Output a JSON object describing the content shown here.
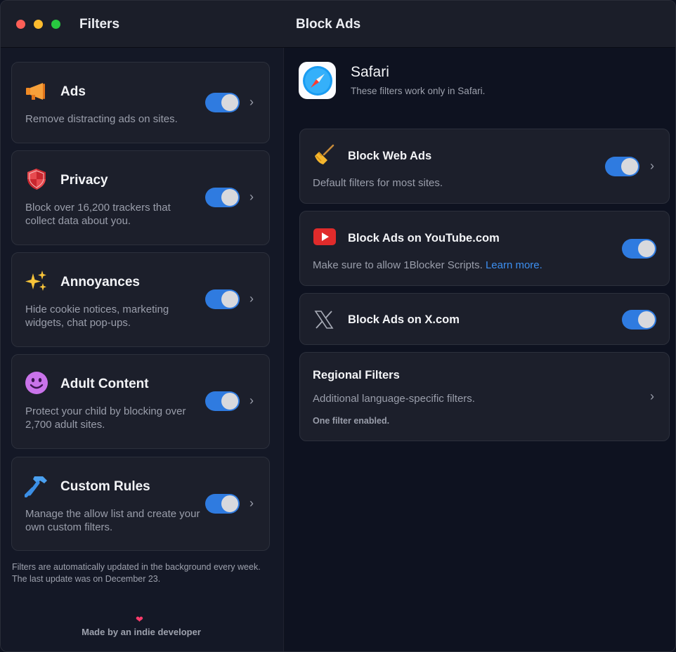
{
  "titlebar": {
    "sidebar_title": "Filters",
    "main_title": "Block Ads"
  },
  "sidebar": {
    "items": [
      {
        "title": "Ads",
        "desc": "Remove distracting ads on sites.",
        "icon": "megaphone-icon",
        "enabled": true
      },
      {
        "title": "Privacy",
        "desc": "Block over 16,200 trackers that collect data about you.",
        "icon": "shield-icon",
        "enabled": true
      },
      {
        "title": "Annoyances",
        "desc": "Hide cookie notices, marketing widgets, chat pop-ups.",
        "icon": "sparkles-icon",
        "enabled": true
      },
      {
        "title": "Adult Content",
        "desc": "Protect your child by blocking over 2,700 adult sites.",
        "icon": "smiley-icon",
        "enabled": true
      },
      {
        "title": "Custom Rules",
        "desc": "Manage the allow list and create your own custom filters.",
        "icon": "hammer-icon",
        "enabled": true
      }
    ],
    "footer_note": "Filters are automatically updated in the background every week. The last update was on December 23.",
    "made_by": "Made by an indie developer"
  },
  "main": {
    "browser": {
      "name": "Safari",
      "desc": "These filters work only in Safari.",
      "icon": "safari-compass-icon"
    },
    "filters": [
      {
        "title": "Block Web Ads",
        "desc": "Default filters for most sites.",
        "icon": "broom-icon",
        "enabled": true
      },
      {
        "title": "Block Ads on YouTube.com",
        "desc": "Make sure to allow 1Blocker Scripts.",
        "link": "Learn more.",
        "icon": "youtube-icon",
        "enabled": true
      },
      {
        "title": "Block Ads on X.com",
        "icon": "x-logo-icon",
        "enabled": true
      }
    ],
    "regional": {
      "title": "Regional Filters",
      "desc": "Additional language-specific filters.",
      "status": "One filter enabled."
    }
  },
  "colors": {
    "accent": "#2f7be0",
    "link": "#3d8ff0",
    "background": "#0e1220",
    "card": "#1c1f2b"
  }
}
